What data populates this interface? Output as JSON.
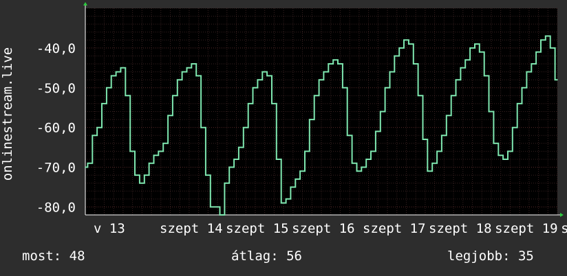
{
  "chart_data": {
    "type": "line",
    "ylabel": "onlinestream.live",
    "ylim": [
      -82,
      -30
    ],
    "yticks": [
      -80,
      -70,
      -60,
      -50,
      -40
    ],
    "ytick_labels": [
      "-80,0",
      "-70,0",
      "-60,0",
      "-50,0",
      "-40,0"
    ],
    "xlim": [
      0,
      100
    ],
    "xtick_labels": [
      "v 13",
      "szept 14",
      "szept 15",
      "szept 16",
      "szept 17",
      "szept 18",
      "szept 19",
      "sz"
    ],
    "xtick_positions": [
      0,
      14,
      28,
      42,
      57,
      71,
      85,
      99
    ],
    "grid": true,
    "color": "#7fe8b0",
    "series": [
      {
        "name": "",
        "x": [
          0,
          1,
          2,
          3,
          4,
          5,
          6,
          7,
          8,
          9,
          10,
          11,
          12,
          13,
          14,
          15,
          16,
          17,
          18,
          19,
          20,
          21,
          22,
          23,
          24,
          25,
          26,
          27,
          28,
          29,
          30,
          31,
          32,
          33,
          34,
          35,
          36,
          37,
          38,
          39,
          40,
          41,
          42,
          43,
          44,
          45,
          46,
          47,
          48,
          49,
          50,
          51,
          52,
          53,
          54,
          55,
          56,
          57,
          58,
          59,
          60,
          61,
          62,
          63,
          64,
          65,
          66,
          67,
          68,
          69,
          70,
          71,
          72,
          73,
          74,
          75,
          76,
          77,
          78,
          79,
          80,
          81,
          82,
          83,
          84,
          85,
          86,
          87,
          88,
          89,
          90,
          91,
          92,
          93,
          94,
          95,
          96,
          97,
          98,
          99,
          100
        ],
        "y": [
          -70,
          -69,
          -62,
          -60,
          -54,
          -50,
          -47,
          -46,
          -45,
          -52,
          -66,
          -72,
          -74,
          -72,
          -69,
          -67,
          -66,
          -64,
          -57,
          -52,
          -48,
          -46,
          -45,
          -44,
          -47,
          -60,
          -72,
          -80,
          -80,
          -82,
          -74,
          -70,
          -68,
          -65,
          -60,
          -54,
          -50,
          -48,
          -46,
          -47,
          -54,
          -68,
          -79,
          -78,
          -75,
          -73,
          -71,
          -66,
          -58,
          -52,
          -48,
          -46,
          -44,
          -43,
          -44,
          -50,
          -62,
          -69,
          -71,
          -70,
          -68,
          -66,
          -61,
          -56,
          -50,
          -46,
          -42,
          -40,
          -38,
          -39,
          -44,
          -52,
          -63,
          -71,
          -69,
          -66,
          -62,
          -57,
          -52,
          -48,
          -45,
          -43,
          -40,
          -39,
          -41,
          -47,
          -56,
          -64,
          -67,
          -68,
          -66,
          -60,
          -54,
          -50,
          -46,
          -44,
          -41,
          -38,
          -37,
          -40,
          -48
        ]
      }
    ]
  },
  "stats": {
    "most": "most: 48",
    "avg": "átlag: 56",
    "best": "legjobb: 35"
  }
}
